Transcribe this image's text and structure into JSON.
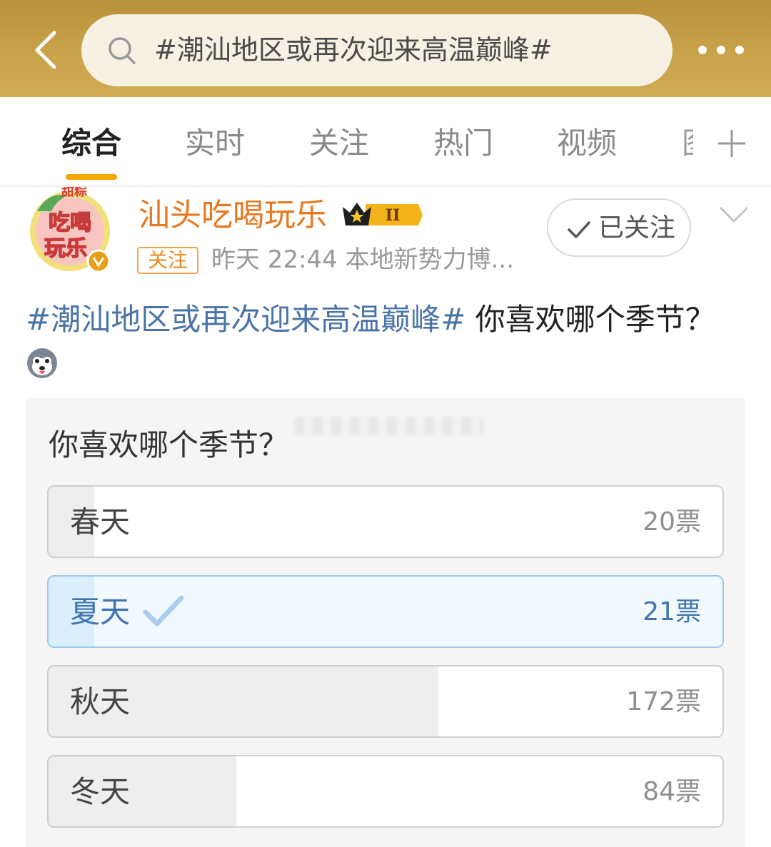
{
  "search": {
    "query": "#潮汕地区或再次迎来高温巅峰#"
  },
  "tabs": [
    {
      "label": "综合",
      "active": true
    },
    {
      "label": "实时",
      "active": false
    },
    {
      "label": "关注",
      "active": false
    },
    {
      "label": "热门",
      "active": false
    },
    {
      "label": "视频",
      "active": false
    },
    {
      "label": "图",
      "active": false
    }
  ],
  "post": {
    "author": "汕头吃喝玩乐",
    "member_level": "II",
    "follow_tag": "关注",
    "meta": "昨天 22:44  本地新势力博...",
    "followed_label": "已关注",
    "topic": "#潮汕地区或再次迎来高温巅峰#",
    "text": " 你喜欢哪个季节？",
    "avatar_text": "吃喝玩乐"
  },
  "poll": {
    "question": "你喜欢哪个季节？",
    "options": [
      {
        "label": "春天",
        "votes": "20票",
        "share": 0.068,
        "chosen": false
      },
      {
        "label": "夏天",
        "votes": "21票",
        "share": 0.068,
        "chosen": true
      },
      {
        "label": "秋天",
        "votes": "172票",
        "share": 0.578,
        "chosen": false
      },
      {
        "label": "冬天",
        "votes": "84票",
        "share": 0.279,
        "chosen": false
      }
    ]
  },
  "colors": {
    "accent": "#f7a500",
    "topic_link": "#4a74a8",
    "username": "#e8781f",
    "chosen_option": "#3f74b0"
  }
}
